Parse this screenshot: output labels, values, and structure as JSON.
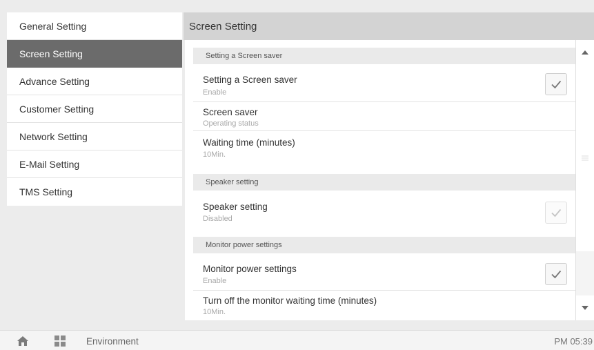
{
  "sidebar": {
    "items": [
      {
        "label": "General Setting",
        "active": false
      },
      {
        "label": "Screen Setting",
        "active": true
      },
      {
        "label": "Advance Setting",
        "active": false
      },
      {
        "label": "Customer Setting",
        "active": false
      },
      {
        "label": "Network Setting",
        "active": false
      },
      {
        "label": "E-Mail Setting",
        "active": false
      },
      {
        "label": "TMS Setting",
        "active": false
      }
    ]
  },
  "main": {
    "title": "Screen Setting",
    "sections": [
      {
        "header": "Setting a Screen saver",
        "rows": [
          {
            "title": "Setting a Screen saver",
            "subtitle": "Enable",
            "checkbox": "checked"
          },
          {
            "title": "Screen saver",
            "subtitle": "Operating status"
          },
          {
            "title": "Waiting time (minutes)",
            "subtitle": "10Min."
          }
        ]
      },
      {
        "header": "Speaker setting",
        "rows": [
          {
            "title": "Speaker setting",
            "subtitle": "Disabled",
            "checkbox": "disabled"
          }
        ]
      },
      {
        "header": "Monitor power settings",
        "rows": [
          {
            "title": "Monitor power settings",
            "subtitle": "Enable",
            "checkbox": "checked"
          },
          {
            "title": "Turn off the monitor waiting time (minutes)",
            "subtitle": "10Min."
          }
        ]
      }
    ]
  },
  "bottombar": {
    "home_icon": "home-icon",
    "apps_icon": "apps-grid-icon",
    "label": "Environment",
    "time": "PM 05:39"
  },
  "colors": {
    "active_item_bg": "#6b6b6b",
    "header_bg": "#d3d3d3",
    "section_bg": "#eaeaea",
    "check_enabled": "#777777",
    "check_disabled": "#c4c4c4"
  }
}
